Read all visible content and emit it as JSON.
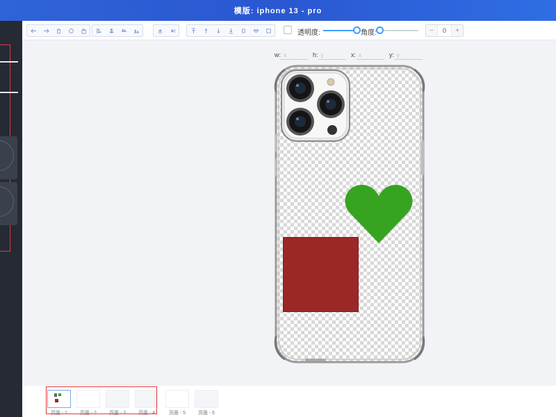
{
  "window": {
    "title": "模版: iphone 13 - pro"
  },
  "toolbar": {
    "groups": [
      {
        "name": "history",
        "items": [
          "undo-icon",
          "redo-icon",
          "delete-icon",
          "refresh-icon",
          "lock-icon"
        ]
      },
      {
        "name": "align",
        "items": [
          "align-left-icon",
          "align-center-h-icon",
          "align-right-icon",
          "align-bottom-icon"
        ]
      },
      {
        "name": "flip",
        "items": [
          "flip-vertical-icon",
          "flip-horizontal-icon"
        ]
      },
      {
        "name": "layer",
        "items": [
          "to-top-icon",
          "up-icon",
          "down-icon",
          "to-bottom-icon",
          "copy-icon",
          "group-icon",
          "ungroup-icon"
        ]
      }
    ],
    "opacity_label": "透明度:",
    "opacity_value_percent": 95,
    "angle_label": "角度:",
    "angle_value_percent": 0,
    "angle_input": "0",
    "decrement": "−",
    "increment": "+"
  },
  "canvas": {
    "fields": [
      {
        "label": "w:",
        "placeholder": "x"
      },
      {
        "label": "h:",
        "placeholder": "y"
      },
      {
        "label": "x:",
        "placeholder": "x"
      },
      {
        "label": "y:",
        "placeholder": "y"
      }
    ],
    "colors": {
      "heart": "#36a420",
      "rect": "#9c2727"
    }
  },
  "pages": {
    "items": [
      {
        "label": "页面 - 1"
      },
      {
        "label": "页面 - 2"
      },
      {
        "label": "页面 - 3"
      },
      {
        "label": "页面 - 4"
      },
      {
        "label": "页面 - 5"
      },
      {
        "label": "页面 - 6"
      }
    ]
  }
}
